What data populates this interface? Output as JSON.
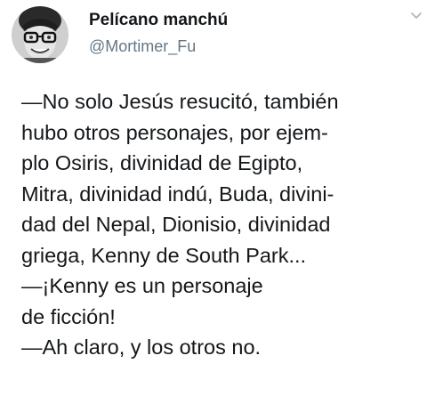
{
  "tweet": {
    "author": {
      "display_name": "Pelícano manchú",
      "handle": "@Mortimer_Fu",
      "avatar_icon": "avatar-photo"
    },
    "menu_icon": "chevron-down-icon",
    "lines": [
      "—No solo Jesús resucitó, también",
      "hubo otros personajes, por ejem-",
      "plo Osiris, divinidad de Egipto,",
      "Mitra, divinidad indú, Buda, divini-",
      "dad del Nepal, Dionisio, divinidad",
      "griega, Kenny de South Park...",
      "—¡Kenny es un personaje",
      "de ficción!",
      "—Ah claro, y los otros no."
    ]
  },
  "colors": {
    "text": "#14171a",
    "secondary": "#657786",
    "background": "#ffffff",
    "chevron": "#aab8c2"
  }
}
